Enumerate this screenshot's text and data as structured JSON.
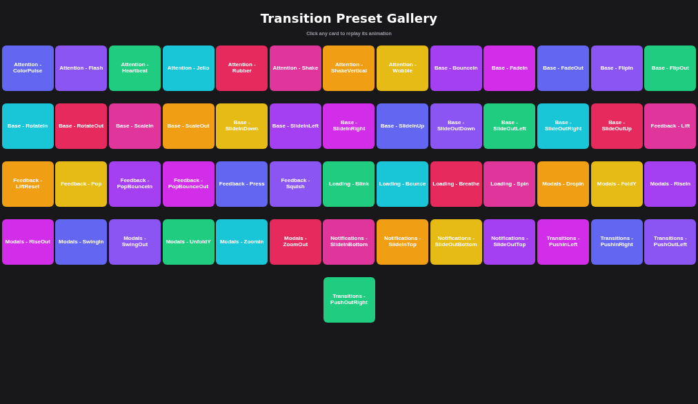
{
  "title": "Transition Preset Gallery",
  "subtitle": "Click any card to replay its animation",
  "cards": [
    {
      "label": "Attention - ColorPulse",
      "color": "#6366f1"
    },
    {
      "label": "Attention - Flash",
      "color": "#8b55f3"
    },
    {
      "label": "Attention - Heartbeat",
      "color": "#20cc80"
    },
    {
      "label": "Attention - Jello",
      "color": "#18c6d8"
    },
    {
      "label": "Attention - Rubber",
      "color": "#e72a5e"
    },
    {
      "label": "Attention - Shake",
      "color": "#e0359a"
    },
    {
      "label": "Attention - ShakeVertical",
      "color": "#f09e14"
    },
    {
      "label": "Attention - Wobble",
      "color": "#e6bb16"
    },
    {
      "label": "Base - BounceIn",
      "color": "#a540f2"
    },
    {
      "label": "Base - FadeIn",
      "color": "#d22de8"
    },
    {
      "label": "Base - FadeOut",
      "color": "#6366f1"
    },
    {
      "label": "Base - FlipIn",
      "color": "#8b55f3"
    },
    {
      "label": "Base - FlipOut",
      "color": "#20cc80"
    },
    {
      "label": "Base - RotateIn",
      "color": "#18c6d8"
    },
    {
      "label": "Base - RotateOut",
      "color": "#e72a5e"
    },
    {
      "label": "Base - ScaleIn",
      "color": "#e0359a"
    },
    {
      "label": "Base - ScaleOut",
      "color": "#f09e14"
    },
    {
      "label": "Base - SlideInDown",
      "color": "#e6bb16"
    },
    {
      "label": "Base - SlideInLeft",
      "color": "#a540f2"
    },
    {
      "label": "Base - SlideInRight",
      "color": "#d22de8"
    },
    {
      "label": "Base - SlideInUp",
      "color": "#6366f1"
    },
    {
      "label": "Base - SlideOutDown",
      "color": "#8b55f3"
    },
    {
      "label": "Base - SlideOutLeft",
      "color": "#20cc80"
    },
    {
      "label": "Base - SlideOutRight",
      "color": "#18c6d8"
    },
    {
      "label": "Base - SlideOutUp",
      "color": "#e72a5e"
    },
    {
      "label": "Feedback - Lift",
      "color": "#e0359a"
    },
    {
      "label": "Feedback - LiftReset",
      "color": "#f09e14"
    },
    {
      "label": "Feedback - Pop",
      "color": "#e6bb16"
    },
    {
      "label": "Feedback - PopBounceIn",
      "color": "#a540f2"
    },
    {
      "label": "Feedback - PopBounceOut",
      "color": "#d22de8"
    },
    {
      "label": "Feedback - Press",
      "color": "#6366f1"
    },
    {
      "label": "Feedback - Squish",
      "color": "#8b55f3"
    },
    {
      "label": "Loading - Blink",
      "color": "#20cc80"
    },
    {
      "label": "Loading - Bounce",
      "color": "#18c6d8"
    },
    {
      "label": "Loading - Breathe",
      "color": "#e72a5e"
    },
    {
      "label": "Loading - Spin",
      "color": "#e0359a"
    },
    {
      "label": "Modals - DropIn",
      "color": "#f09e14"
    },
    {
      "label": "Modals - FoldY",
      "color": "#e6bb16"
    },
    {
      "label": "Modals - RiseIn",
      "color": "#a540f2"
    },
    {
      "label": "Modals - RiseOut",
      "color": "#d22de8"
    },
    {
      "label": "Modals - SwingIn",
      "color": "#6366f1"
    },
    {
      "label": "Modals - SwingOut",
      "color": "#8b55f3"
    },
    {
      "label": "Modals - UnfoldY",
      "color": "#20cc80"
    },
    {
      "label": "Modals - ZoomIn",
      "color": "#18c6d8"
    },
    {
      "label": "Modals - ZoomOut",
      "color": "#e72a5e"
    },
    {
      "label": "Notifications - SlideInBottom",
      "color": "#e0359a"
    },
    {
      "label": "Notifications - SlideInTop",
      "color": "#f09e14"
    },
    {
      "label": "Notifications - SlideOutBottom",
      "color": "#e6bb16"
    },
    {
      "label": "Notifications - SlideOutTop",
      "color": "#a540f2"
    },
    {
      "label": "Transitions - PushInLeft",
      "color": "#d22de8"
    },
    {
      "label": "Transitions - PushInRight",
      "color": "#6366f1"
    },
    {
      "label": "Transitions - PushOutLeft",
      "color": "#8b55f3"
    },
    {
      "label": "Transitions - PushOutRight",
      "color": "#20cc80"
    }
  ]
}
